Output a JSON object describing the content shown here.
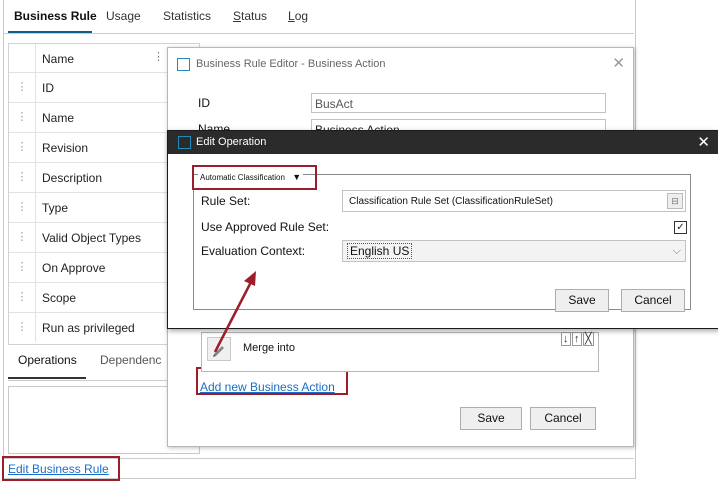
{
  "tabs": [
    {
      "label": "Business Rule"
    },
    {
      "label": "Usage"
    },
    {
      "label": "Statistics"
    },
    {
      "label_underlined": "S",
      "label_rest": "tatus"
    },
    {
      "label_underlined": "L",
      "label_rest": "og"
    }
  ],
  "props_table": {
    "header": "Name",
    "rows": [
      "ID",
      "Name",
      "Revision",
      "Description",
      "Type",
      "Valid Object Types",
      "On Approve",
      "Scope",
      "Run as privileged"
    ]
  },
  "bottom_tabs": [
    "Operations",
    "Dependenc"
  ],
  "edit_link": "Edit Business Rule",
  "editor": {
    "title": "Business Rule Editor - Business Action",
    "id_label": "ID",
    "id_value": "BusAct",
    "name_label": "Name",
    "name_value": "Business Action",
    "merge_text": "Merge  into",
    "add_link": "Add new Business Action",
    "save": "Save",
    "cancel": "Cancel"
  },
  "edit_operation": {
    "title": "Edit Operation",
    "operation_dropdown": "Automatic Classification",
    "rule_set_label": "Rule Set:",
    "rule_set_value": "Classification Rule Set (ClassificationRuleSet)",
    "use_approved_label": "Use Approved Rule Set:",
    "use_approved_checked": true,
    "eval_context_label": "Evaluation Context:",
    "eval_context_value": "English US",
    "save": "Save",
    "cancel": "Cancel"
  }
}
